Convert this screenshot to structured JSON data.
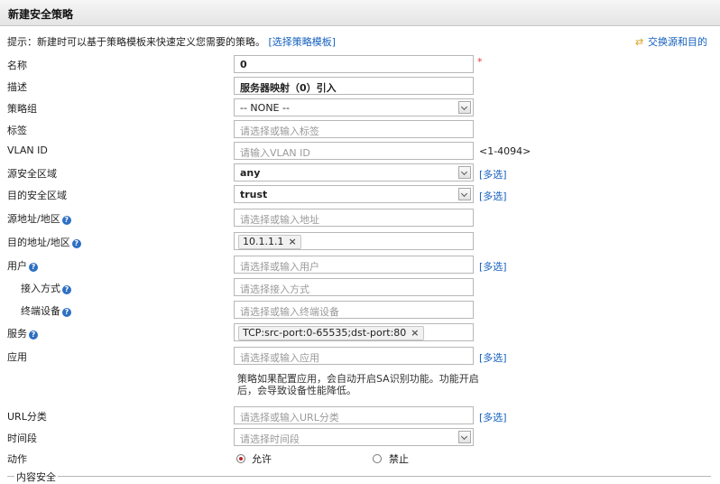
{
  "header": {
    "title": "新建安全策略"
  },
  "hint": {
    "text": "提示：新建时可以基于策略模板来快速定义您需要的策略。",
    "link": "[选择策略模板]"
  },
  "swap_link": "交换源和目的",
  "fields": {
    "name": {
      "label": "名称",
      "value": "0",
      "required_mark": "*"
    },
    "description": {
      "label": "描述",
      "value": "服务器映射（0）引入"
    },
    "policy_group": {
      "label": "策略组",
      "value": "-- NONE --"
    },
    "tag": {
      "label": "标签",
      "placeholder": "请选择或输入标签"
    },
    "vlan": {
      "label": "VLAN ID",
      "placeholder": "请输入VLAN ID",
      "range": "<1-4094>"
    },
    "src_zone": {
      "label": "源安全区域",
      "value": "any",
      "multi": "[多选]"
    },
    "dst_zone": {
      "label": "目的安全区域",
      "value": "trust",
      "multi": "[多选]"
    },
    "src_addr": {
      "label": "源地址/地区",
      "placeholder": "请选择或输入地址"
    },
    "dst_addr": {
      "label": "目的地址/地区",
      "tag": "10.1.1.1"
    },
    "user": {
      "label": "用户",
      "placeholder": "请选择或输入用户",
      "multi": "[多选]"
    },
    "access_mode": {
      "label": "接入方式",
      "placeholder": "请选择接入方式"
    },
    "terminal": {
      "label": "终端设备",
      "placeholder": "请选择或输入终端设备"
    },
    "service": {
      "label": "服务",
      "tag": "TCP:src-port:0-65535;dst-port:80"
    },
    "app": {
      "label": "应用",
      "placeholder": "请选择或输入应用",
      "multi": "[多选]",
      "note": "策略如果配置应用，会自动开启SA识别功能。功能开启后，会导致设备性能降低。"
    },
    "url": {
      "label": "URL分类",
      "placeholder": "请选择或输入URL分类",
      "multi": "[多选]"
    },
    "time": {
      "label": "时间段",
      "placeholder": "请选择时间段"
    },
    "action": {
      "label": "动作",
      "allow": "允许",
      "deny": "禁止"
    }
  },
  "section": {
    "label": "内容安全"
  },
  "help_glyph": "?",
  "remove_glyph": "×",
  "icons": {
    "help": "help-icon",
    "swap": "swap-icon",
    "remove": "remove-tag-icon",
    "dropdown": "chevron-down-icon"
  },
  "colors": {
    "link": "#1560bd",
    "required": "#e23b3b",
    "help": "#2d6fc2",
    "radio_selected": "#c0262c"
  }
}
